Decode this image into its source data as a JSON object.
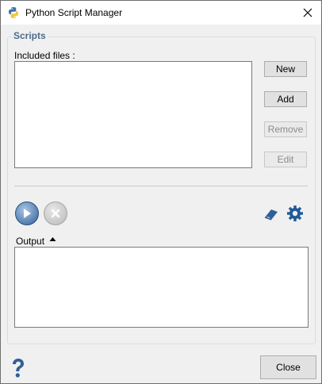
{
  "window": {
    "title": "Python Script Manager"
  },
  "scripts": {
    "group_title": "Scripts",
    "included_files_label": "Included files :",
    "files": [],
    "buttons": {
      "new": "New",
      "add": "Add",
      "remove": "Remove",
      "edit": "Edit"
    },
    "remove_enabled": false,
    "edit_enabled": false
  },
  "toolbar": {
    "run_icon": "play-icon",
    "stop_icon": "stop-icon",
    "stop_enabled": false,
    "clear_icon": "eraser-icon",
    "settings_icon": "gear-icon"
  },
  "output": {
    "label": "Output",
    "toggle_icon": "triangle-up-icon",
    "text": ""
  },
  "footer": {
    "help_icon": "question-mark-icon",
    "close_label": "Close"
  },
  "colors": {
    "group_title": "#4e6d8c",
    "accent_blue": "#2f5f98"
  }
}
